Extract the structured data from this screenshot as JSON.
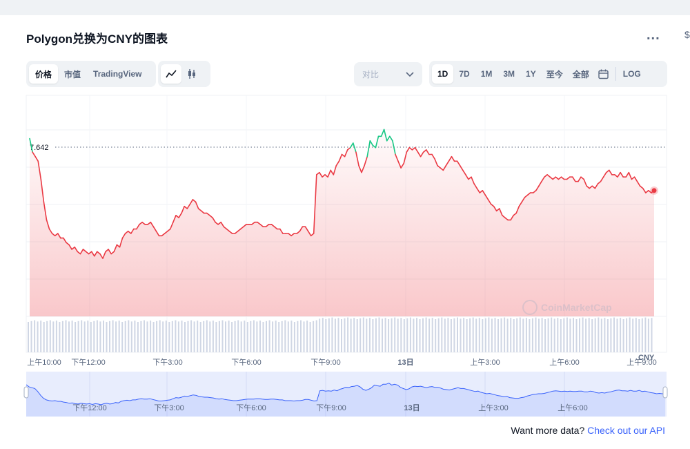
{
  "title": "Polygon兑换为CNY的图表",
  "more_label": "...",
  "edge_char": "$",
  "tabs": [
    {
      "label": "价格",
      "active": true
    },
    {
      "label": "市值",
      "active": false
    },
    {
      "label": "TradingView",
      "active": false
    }
  ],
  "chart_type_icons": [
    "line-chart-icon",
    "candlestick-icon"
  ],
  "compare": {
    "placeholder": "对比"
  },
  "ranges": [
    {
      "label": "1D",
      "active": true
    },
    {
      "label": "7D",
      "active": false
    },
    {
      "label": "1M",
      "active": false
    },
    {
      "label": "3M",
      "active": false
    },
    {
      "label": "1Y",
      "active": false
    },
    {
      "label": "至今",
      "active": false
    },
    {
      "label": "全部",
      "active": false
    }
  ],
  "log_label": "LOG",
  "watermark": "CoinMarketCap",
  "currency_label": "CNY",
  "api_text": "Want more data?",
  "api_link": "Check out our API",
  "colors": {
    "down": "#ea3943",
    "up": "#16c784",
    "volume": "#cfd6e4",
    "nav_line": "#3861fb"
  },
  "chart_data": {
    "type": "line",
    "reference_value": 7.642,
    "reference_label": "7.642",
    "x_ticks": [
      "上午10:00",
      "下午12:00",
      "下午3:00",
      "下午6:00",
      "下午9:00",
      "13日",
      "上午3:00",
      "上午6:00",
      "上午9:00"
    ],
    "nav_ticks": [
      "下午12:00",
      "下午3:00",
      "下午6:00",
      "下午9:00",
      "13日",
      "上午3:00",
      "上午6:00"
    ],
    "series": [
      {
        "values": [
          7.68,
          7.62,
          7.6,
          7.58,
          7.5,
          7.4,
          7.32,
          7.28,
          7.26,
          7.25,
          7.26,
          7.24,
          7.24,
          7.22,
          7.21,
          7.19,
          7.2,
          7.18,
          7.17,
          7.19,
          7.18,
          7.17,
          7.18,
          7.16,
          7.18,
          7.17,
          7.15,
          7.18,
          7.19,
          7.17,
          7.18,
          7.21,
          7.2,
          7.24,
          7.26,
          7.27,
          7.26,
          7.28,
          7.28,
          7.3,
          7.31,
          7.3,
          7.3,
          7.31,
          7.29,
          7.27,
          7.25,
          7.25,
          7.26,
          7.27,
          7.28,
          7.31,
          7.34,
          7.33,
          7.35,
          7.38,
          7.37,
          7.39,
          7.41,
          7.4,
          7.37,
          7.36,
          7.35,
          7.35,
          7.34,
          7.33,
          7.31,
          7.3,
          7.31,
          7.29,
          7.28,
          7.27,
          7.26,
          7.26,
          7.27,
          7.28,
          7.29,
          7.3,
          7.3,
          7.3,
          7.31,
          7.31,
          7.3,
          7.29,
          7.29,
          7.3,
          7.3,
          7.29,
          7.28,
          7.28,
          7.26,
          7.26,
          7.26,
          7.25,
          7.26,
          7.26,
          7.27,
          7.29,
          7.29,
          7.27,
          7.25,
          7.26,
          7.52,
          7.53,
          7.51,
          7.52,
          7.51,
          7.54,
          7.52,
          7.56,
          7.58,
          7.61,
          7.6,
          7.63,
          7.64,
          7.66,
          7.62,
          7.56,
          7.53,
          7.56,
          7.6,
          7.67,
          7.65,
          7.64,
          7.69,
          7.69,
          7.72,
          7.67,
          7.69,
          7.67,
          7.61,
          7.58,
          7.55,
          7.57,
          7.62,
          7.64,
          7.63,
          7.64,
          7.62,
          7.6,
          7.62,
          7.63,
          7.61,
          7.61,
          7.59,
          7.56,
          7.55,
          7.54,
          7.56,
          7.58,
          7.6,
          7.58,
          7.58,
          7.56,
          7.54,
          7.52,
          7.5,
          7.51,
          7.48,
          7.46,
          7.44,
          7.45,
          7.43,
          7.41,
          7.39,
          7.38,
          7.36,
          7.37,
          7.34,
          7.33,
          7.32,
          7.32,
          7.34,
          7.35,
          7.38,
          7.4,
          7.42,
          7.43,
          7.44,
          7.44,
          7.45,
          7.47,
          7.49,
          7.51,
          7.52,
          7.51,
          7.5,
          7.51,
          7.5,
          7.51,
          7.5,
          7.5,
          7.51,
          7.51,
          7.49,
          7.49,
          7.51,
          7.5,
          7.47,
          7.46,
          7.47,
          7.46,
          7.48,
          7.49,
          7.51,
          7.53,
          7.54,
          7.52,
          7.52,
          7.51,
          7.53,
          7.51,
          7.51,
          7.53,
          7.5,
          7.51,
          7.49,
          7.47,
          7.46,
          7.44,
          7.45,
          7.44,
          7.45
        ]
      }
    ]
  }
}
